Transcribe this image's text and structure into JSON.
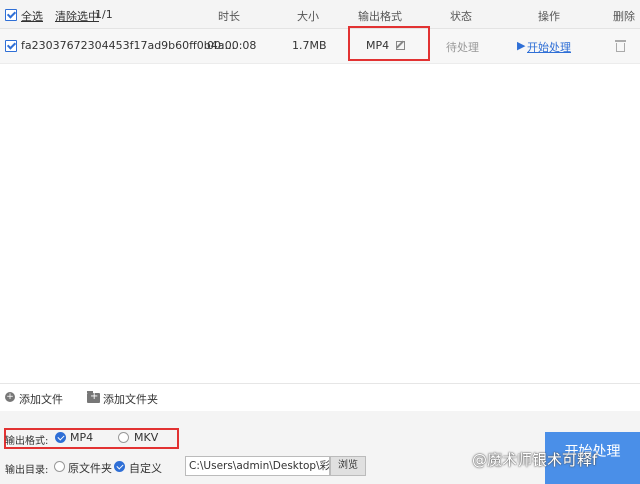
{
  "header": {
    "select_all": "全选",
    "clear_selected": "清除选中",
    "count": "1/1",
    "col_duration": "时长",
    "col_size": "大小",
    "col_format": "输出格式",
    "col_status": "状态",
    "col_action": "操作",
    "col_delete": "删除"
  },
  "files": [
    {
      "name": "fa23037672304453f17ad9b60ff0b4a...",
      "duration": "00:00:08",
      "size": "1.7MB",
      "format": "MP4",
      "status": "待处理",
      "action": "开始处理"
    }
  ],
  "toolbar": {
    "add_file": "添加文件",
    "add_folder": "添加文件夹"
  },
  "output": {
    "format_label": "输出格式:",
    "format_options": [
      "MP4",
      "MKV"
    ],
    "selected_format": "MP4",
    "dir_label": "输出目录:",
    "dir_original": "原文件夹",
    "dir_custom": "自定义",
    "path": "C:\\Users\\admin\\Desktop\\彩",
    "browse": "浏览"
  },
  "start_button": "开始处理",
  "watermark": "@魔术师银术可释f",
  "colors": {
    "accent": "#2f6fd6",
    "highlight_box": "#e23232",
    "start_button": "#4a8fe8"
  }
}
